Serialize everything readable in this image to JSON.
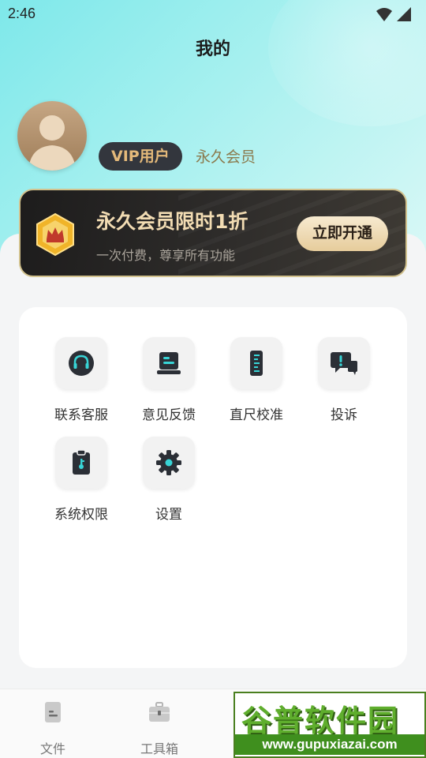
{
  "status_bar": {
    "time": "2:46",
    "icons": [
      "wifi-icon",
      "signal-icon"
    ]
  },
  "header": {
    "title": "我的"
  },
  "profile": {
    "vip_badge": "VIP用户",
    "member_type": "永久会员"
  },
  "promo": {
    "title": "永久会员限时1折",
    "subtitle": "一次付费，尊享所有功能",
    "button": "立即开通"
  },
  "tools": [
    {
      "label": "联系客服",
      "icon": "headset-icon"
    },
    {
      "label": "意见反馈",
      "icon": "feedback-icon"
    },
    {
      "label": "直尺校准",
      "icon": "ruler-icon"
    },
    {
      "label": "投诉",
      "icon": "complaint-icon"
    },
    {
      "label": "系统权限",
      "icon": "permission-icon"
    },
    {
      "label": "设置",
      "icon": "settings-gear-icon"
    }
  ],
  "bottom_nav": [
    {
      "label": "文件",
      "icon": "file-icon"
    },
    {
      "label": "工具箱",
      "icon": "toolbox-icon"
    }
  ],
  "watermark": {
    "logo": "谷普软件园",
    "url": "www.gupuxiazai.com"
  },
  "colors": {
    "accent_cyan": "#7ee8ea",
    "gold": "#e4b97a",
    "dark_card": "#1d1c1c"
  }
}
